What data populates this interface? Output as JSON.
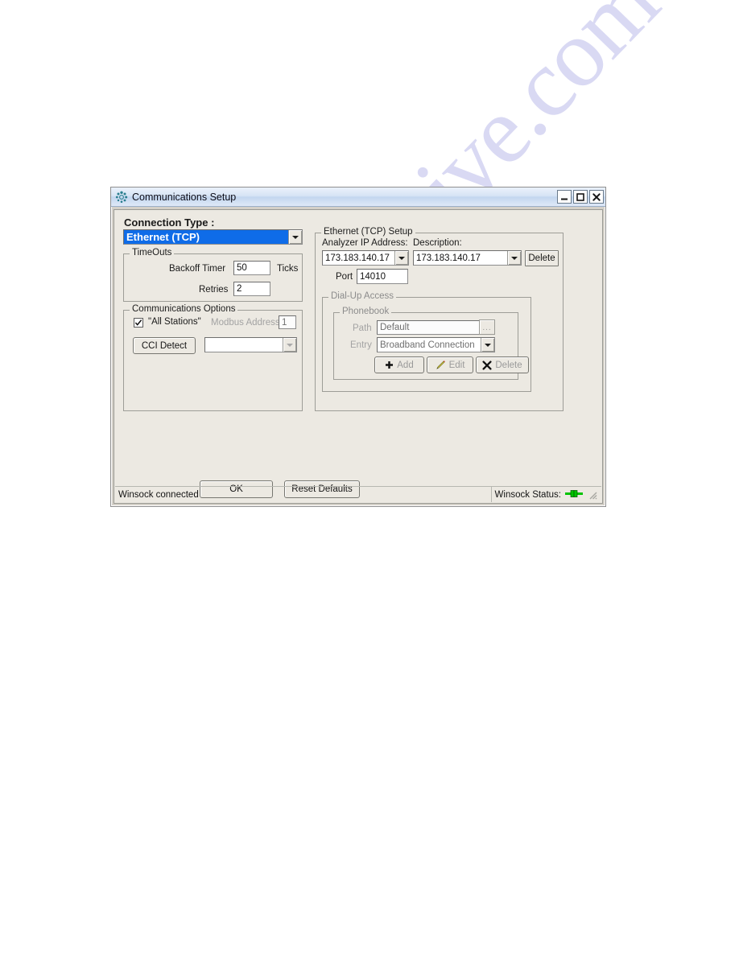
{
  "window": {
    "title": "Communications Setup",
    "icon": "settings-spinner-icon",
    "minimize_label": "_",
    "maximize_label": "□",
    "close_label": "✕"
  },
  "connection_type": {
    "label": "Connection Type :",
    "selected": "Ethernet (TCP)",
    "highlight_color": "#0f6ce8"
  },
  "timeouts": {
    "legend": "TimeOuts",
    "backoff_label": "Backoff Timer",
    "backoff_value": "50",
    "backoff_units": "Ticks",
    "retries_label": "Retries",
    "retries_value": "2"
  },
  "comm_options": {
    "legend": "Communications Options",
    "all_stations_label": "\"All Stations\"",
    "all_stations_checked": true,
    "modbus_label": "Modbus Address",
    "modbus_value": "1",
    "cci_detect_label": "CCI Detect",
    "cci_combo_value": ""
  },
  "ethernet_setup": {
    "legend": "Ethernet (TCP)  Setup",
    "ip_label": "Analyzer IP Address:",
    "ip_value": "173.183.140.17",
    "description_label": "Description:",
    "description_value": "173.183.140.17",
    "delete_label": "Delete",
    "port_label": "Port",
    "port_value": "14010"
  },
  "dialup": {
    "legend": "Dial-Up Access",
    "phonebook": {
      "legend": "Phonebook",
      "path_label": "Path",
      "path_value": "Default",
      "browse_label": "...",
      "entry_label": "Entry",
      "entry_value": "Broadband Connection",
      "add_label": "Add",
      "edit_label": "Edit",
      "delete_label": "Delete",
      "add_icon": "plus-icon",
      "edit_icon": "pencil-icon",
      "delete_icon": "x-icon"
    }
  },
  "footer": {
    "ok_label": "OK",
    "reset_label": "Reset Defaults"
  },
  "statusbar": {
    "message": "Winsock connected",
    "status_label": "Winsock Status:",
    "status_icon": "green-connector-icon",
    "status_color": "#00c000",
    "grip_icon": "resize-grip-icon"
  },
  "watermark": {
    "text": "manualshive.com"
  }
}
